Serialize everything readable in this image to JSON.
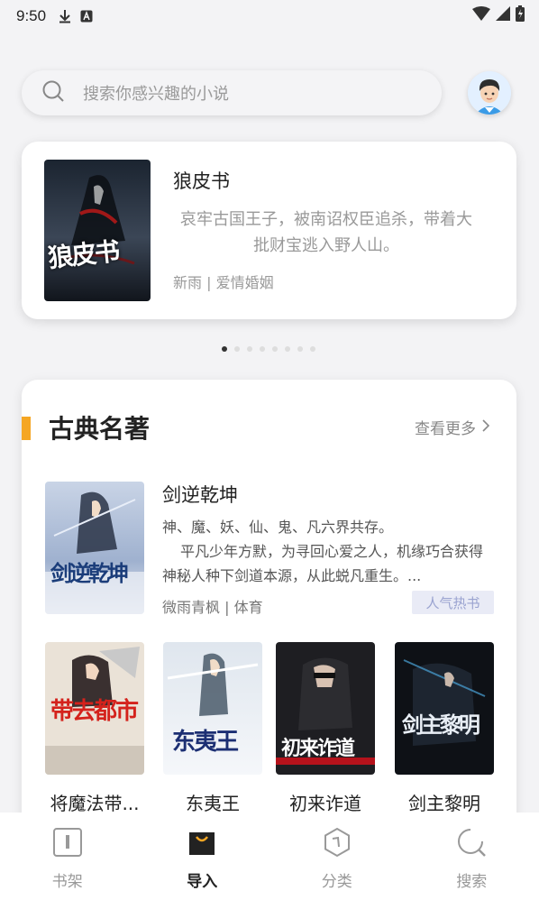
{
  "status_bar": {
    "time": "9:50"
  },
  "search": {
    "placeholder": "搜索你感兴趣的小说"
  },
  "banner": {
    "title": "狼皮书",
    "description": "哀牢古国王子，被南诏权臣追杀，带着大批财宝逃入野人山。",
    "meta": "新雨 | 爱情婚姻",
    "cover_text": "狼皮书"
  },
  "carousel": {
    "count": 8,
    "active": 0
  },
  "section": {
    "title": "古典名著",
    "see_more": "查看更多",
    "featured": {
      "title": "剑逆乾坤",
      "desc_line1": "神、魔、妖、仙、鬼、凡六界共存。",
      "desc_line2": "平凡少年方默，为寻回心爱之人，机缘巧合获得神秘人种下剑道本源，从此蜕凡重生。...",
      "meta": "微雨青枫 | 体育",
      "badge": "人气热书",
      "cover_text": "剑逆乾坤"
    },
    "books": [
      {
        "title": "将魔法带...",
        "cover_text": "带去都市"
      },
      {
        "title": "东夷王",
        "cover_text": "东夷王"
      },
      {
        "title": "初来诈道",
        "cover_text": "初来诈道"
      },
      {
        "title": "剑主黎明",
        "cover_text": "剑主黎明"
      }
    ]
  },
  "nav": {
    "items": [
      {
        "label": "书架",
        "icon": "bookshelf-icon"
      },
      {
        "label": "导入",
        "icon": "import-bag-icon"
      },
      {
        "label": "分类",
        "icon": "category-icon"
      },
      {
        "label": "搜索",
        "icon": "search-icon"
      }
    ],
    "active": 1
  },
  "colors": {
    "accent": "#f5a623",
    "badge_bg": "#e9ebf6",
    "badge_text": "#9aa3d0",
    "background": "#f3f3f5"
  }
}
